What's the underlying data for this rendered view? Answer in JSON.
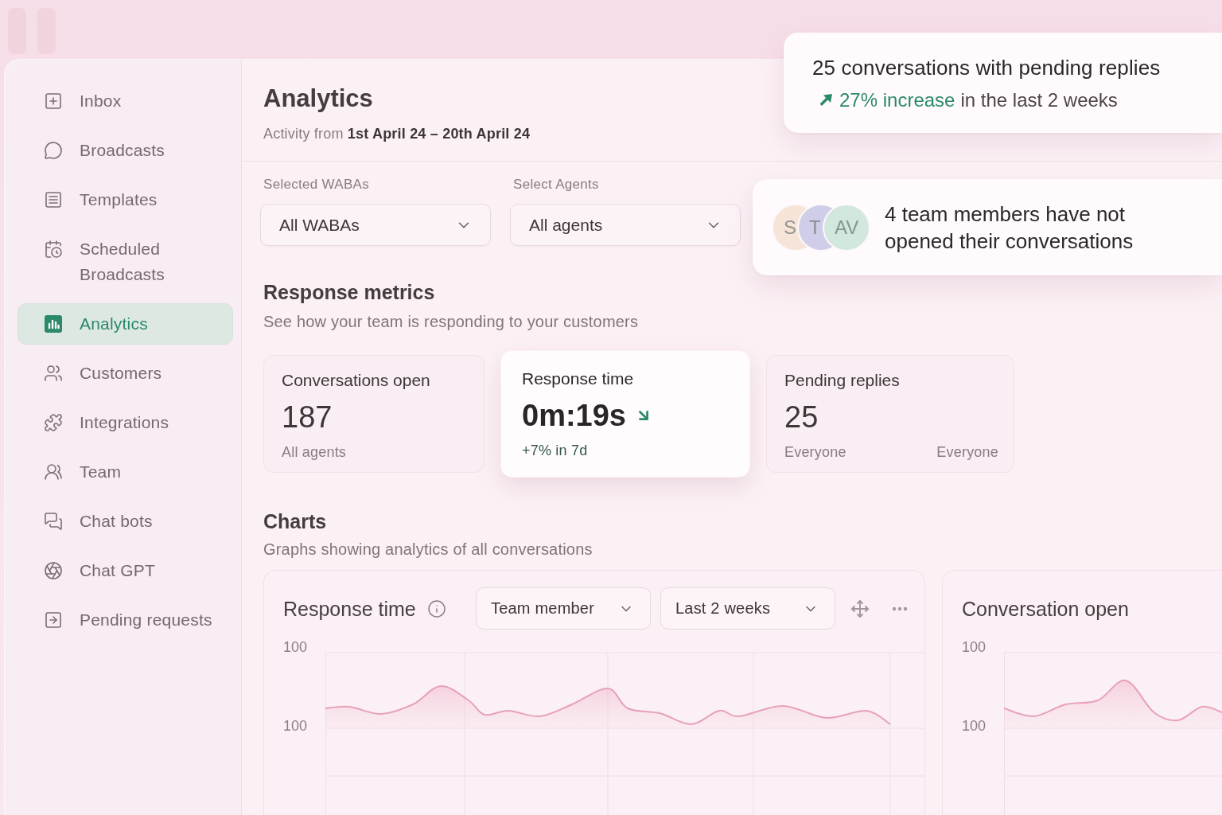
{
  "sidebar": {
    "items": [
      {
        "label": "Inbox",
        "selected": false
      },
      {
        "label": "Broadcasts",
        "selected": false
      },
      {
        "label": "Templates",
        "selected": false
      },
      {
        "label": "Scheduled Broadcasts",
        "selected": false
      },
      {
        "label": "Analytics",
        "selected": true
      },
      {
        "label": "Customers",
        "selected": false
      },
      {
        "label": "Integrations",
        "selected": false
      },
      {
        "label": "Team",
        "selected": false
      },
      {
        "label": "Chat bots",
        "selected": false
      },
      {
        "label": "Chat GPT",
        "selected": false
      },
      {
        "label": "Pending requests",
        "selected": false
      }
    ]
  },
  "header": {
    "title": "Analytics",
    "subtitle": "Activity from **1st April 24 – 20th April 24**"
  },
  "filters": [
    {
      "label": "Selected WABAs",
      "value": "All WABAs"
    },
    {
      "label": "Select Agents",
      "value": "All agents"
    }
  ],
  "response_metrics": {
    "title": "Response metrics",
    "subtitle": "See how your team is responding to your customers",
    "cards": [
      {
        "title": "Conversations open",
        "value": "187",
        "captions": [
          "All agents"
        ],
        "highlighted": false
      },
      {
        "title": "Response time",
        "value": "0m:19s",
        "falling": true,
        "captions": [
          "+7% in 7d"
        ],
        "highlighted": true
      },
      {
        "title": "Pending replies",
        "value": "25",
        "captions": [
          "Everyone",
          "Everyone"
        ],
        "highlighted": false
      }
    ]
  },
  "charts": {
    "title": "Charts",
    "subtitle": "Graphs showing analytics of all conversations",
    "cards": [
      {
        "title": "Response time",
        "filters": [
          "Team member",
          "Last 2 weeks"
        ],
        "y_axis_labels": [
          "100",
          "100"
        ]
      },
      {
        "title": "Conversation open",
        "y_axis_labels": [
          "100",
          "100"
        ]
      }
    ]
  },
  "notifications": [
    {
      "kind": "trend",
      "title": "25 conversations with pending replies",
      "rising": true,
      "change": "27% increase",
      "period": "in the last 2 weeks"
    },
    {
      "kind": "members",
      "avatars": [
        {
          "initials": "S",
          "color": "#f6e4d9"
        },
        {
          "initials": "T",
          "color": "#cfcde8"
        },
        {
          "initials": "AV",
          "color": "#d2e7de"
        }
      ],
      "message": "4 team members have not opened their conversations"
    }
  ]
}
